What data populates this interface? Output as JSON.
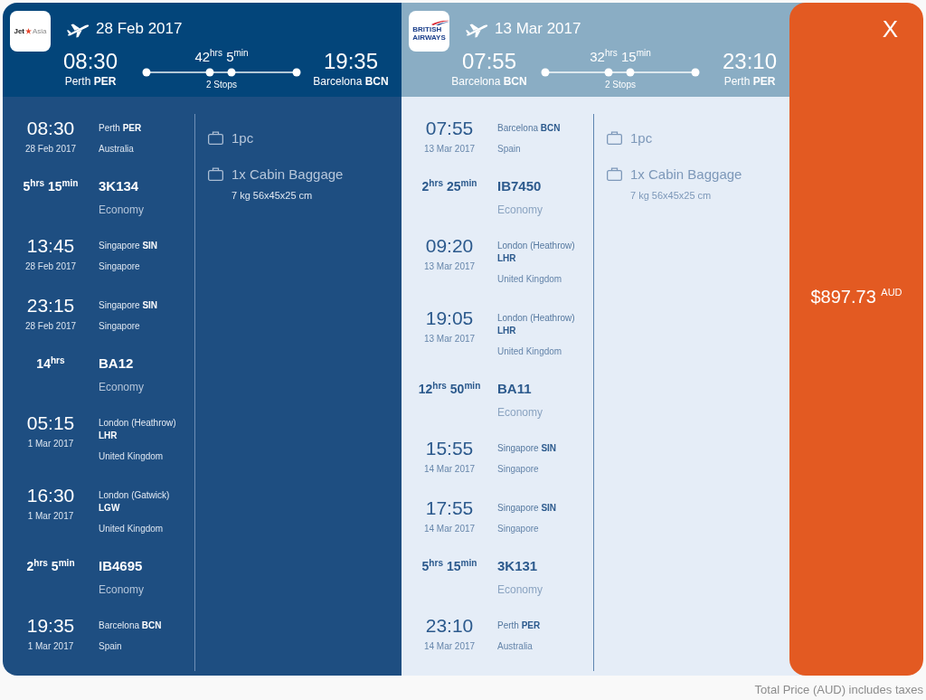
{
  "legs": [
    {
      "kind": "outbound",
      "logo": {
        "kind": "star",
        "words": [
          "Jet",
          "Asia"
        ]
      },
      "date": "28 Feb 2017",
      "departure": {
        "time": "08:30",
        "place": "Perth **PER**"
      },
      "duration": "42$^{hrs}$ 5$^{min}$",
      "stops": "2 Stops",
      "arrival": {
        "time": "19:35",
        "place": "Barcelona **BCN**"
      },
      "segments": [
        {
          "kind": "stop",
          "time": "08:30",
          "date": "28 Feb 2017",
          "place": "Perth **PER**",
          "country": "Australia"
        },
        {
          "kind": "flight",
          "duration": "5$^{hrs}$ 15$^{min}$",
          "flight": "3K134",
          "cabin": "Economy"
        },
        {
          "kind": "stop",
          "time": "13:45",
          "date": "28 Feb 2017",
          "place": "Singapore **SIN**",
          "country": "Singapore"
        },
        {
          "kind": "stop",
          "time": "23:15",
          "date": "28 Feb 2017",
          "place": "Singapore **SIN**",
          "country": "Singapore"
        },
        {
          "kind": "flight",
          "duration": "14$^{hrs}$",
          "flight": "BA12",
          "cabin": "Economy"
        },
        {
          "kind": "stop",
          "time": "05:15",
          "date": "1 Mar 2017",
          "place": "London (Heathrow) **LHR**",
          "country": "United Kingdom"
        },
        {
          "kind": "stop",
          "time": "16:30",
          "date": "1 Mar 2017",
          "place": "London (Gatwick) **LGW**",
          "country": "United Kingdom"
        },
        {
          "kind": "flight",
          "duration": "2$^{hrs}$ 5$^{min}$",
          "flight": "IB4695",
          "cabin": "Economy"
        },
        {
          "kind": "stop",
          "time": "19:35",
          "date": "1 Mar 2017",
          "place": "Barcelona **BCN**",
          "country": "Spain"
        }
      ],
      "baggage": [
        {
          "text": "1pc"
        },
        {
          "text": "1x Cabin Baggage",
          "detail": "7 kg 56x45x25 cm"
        }
      ]
    },
    {
      "kind": "return",
      "logo": {
        "kind": "ribbon",
        "words": [
          "BRITISH",
          "AIRWAYS"
        ]
      },
      "date": "13 Mar 2017",
      "departure": {
        "time": "07:55",
        "place": "Barcelona **BCN**"
      },
      "duration": "32$^{hrs}$ 15$^{min}$",
      "stops": "2 Stops",
      "arrival": {
        "time": "23:10",
        "place": "Perth **PER**"
      },
      "segments": [
        {
          "kind": "stop",
          "time": "07:55",
          "date": "13 Mar 2017",
          "place": "Barcelona **BCN**",
          "country": "Spain"
        },
        {
          "kind": "flight",
          "duration": "2$^{hrs}$ 25$^{min}$",
          "flight": "IB7450",
          "cabin": "Economy"
        },
        {
          "kind": "stop",
          "time": "09:20",
          "date": "13 Mar 2017",
          "place": "London (Heathrow) **LHR**",
          "country": "United Kingdom"
        },
        {
          "kind": "stop",
          "time": "19:05",
          "date": "13 Mar 2017",
          "place": "London (Heathrow) **LHR**",
          "country": "United Kingdom"
        },
        {
          "kind": "flight",
          "duration": "12$^{hrs}$ 50$^{min}$",
          "flight": "BA11",
          "cabin": "Economy"
        },
        {
          "kind": "stop",
          "time": "15:55",
          "date": "14 Mar 2017",
          "place": "Singapore **SIN**",
          "country": "Singapore"
        },
        {
          "kind": "stop",
          "time": "17:55",
          "date": "14 Mar 2017",
          "place": "Singapore **SIN**",
          "country": "Singapore"
        },
        {
          "kind": "flight",
          "duration": "5$^{hrs}$ 15$^{min}$",
          "flight": "3K131",
          "cabin": "Economy"
        },
        {
          "kind": "stop",
          "time": "23:10",
          "date": "14 Mar 2017",
          "place": "Perth **PER**",
          "country": "Australia"
        }
      ],
      "baggage": [
        {
          "text": "1pc"
        },
        {
          "text": "1x Cabin Baggage",
          "detail": "7 kg 56x45x25 cm"
        }
      ]
    }
  ],
  "price": {
    "close": "X",
    "total": "$897.73 $^{AUD}$"
  },
  "footer": "Total Price (AUD) includes taxes"
}
